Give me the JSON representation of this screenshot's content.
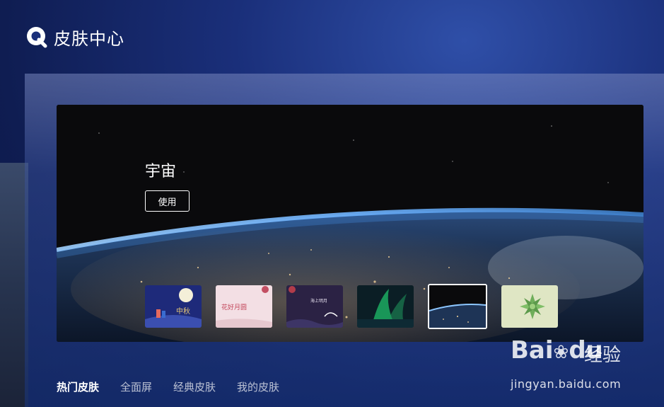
{
  "header": {
    "title": "皮肤中心"
  },
  "hero": {
    "skin_name": "宇宙",
    "use_label": "使用",
    "thumbnails": [
      {
        "name": "mid-autumn",
        "caption": "中秋"
      },
      {
        "name": "flowers-moon",
        "caption": "花好月圆"
      },
      {
        "name": "sea-moon",
        "caption": "海上明月"
      },
      {
        "name": "aurora",
        "caption": ""
      },
      {
        "name": "earth-space",
        "caption": "",
        "selected": true
      },
      {
        "name": "succulent",
        "caption": ""
      }
    ]
  },
  "tabs": [
    {
      "label": "热门皮肤",
      "active": true
    },
    {
      "label": "全面屏",
      "active": false
    },
    {
      "label": "经典皮肤",
      "active": false
    },
    {
      "label": "我的皮肤",
      "active": false
    }
  ],
  "watermark": {
    "brand": "Bai",
    "brand2": "du",
    "cn": "经验",
    "url": "jingyan.baidu.com"
  },
  "colors": {
    "accent": "#ffffff",
    "bg_deep": "#0f1d52",
    "bg_light": "#2f4fa8"
  }
}
